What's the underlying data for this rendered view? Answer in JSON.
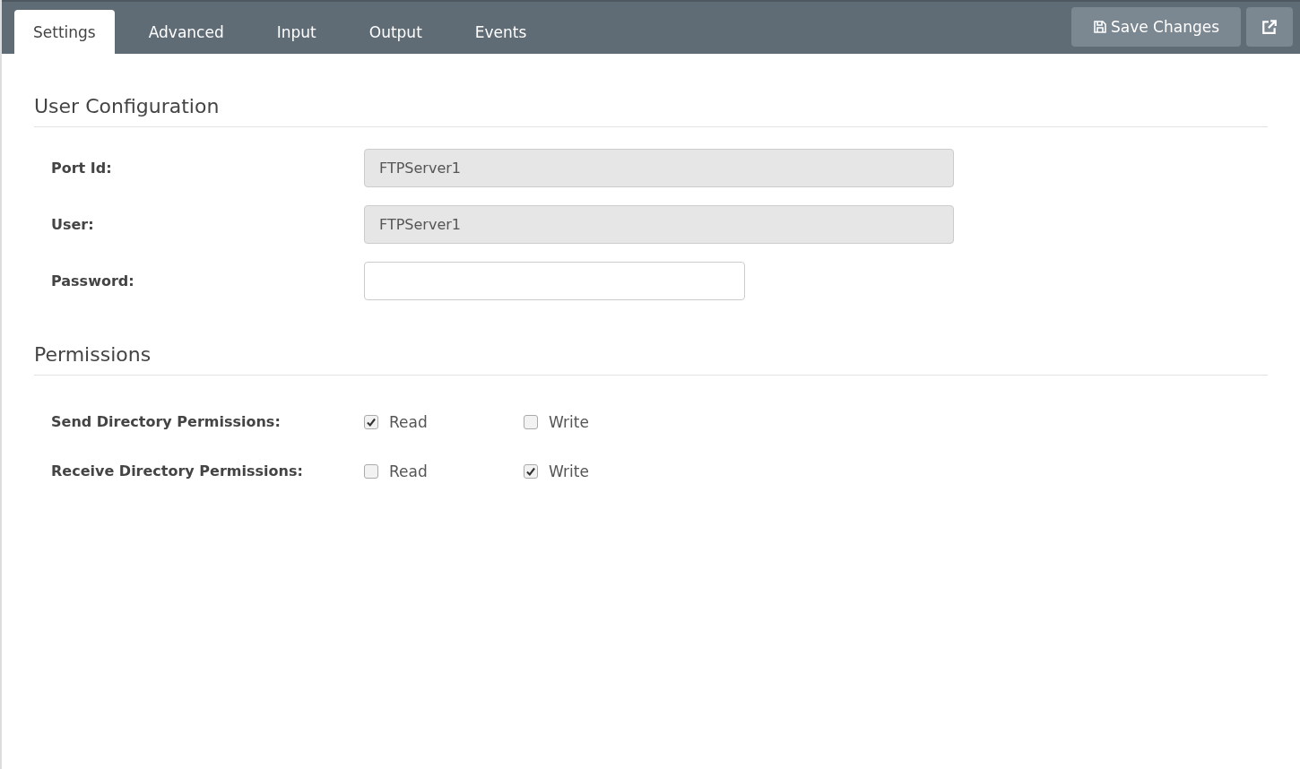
{
  "tabs": [
    {
      "label": "Settings",
      "selected": true
    },
    {
      "label": "Advanced",
      "selected": false
    },
    {
      "label": "Input",
      "selected": false
    },
    {
      "label": "Output",
      "selected": false
    },
    {
      "label": "Events",
      "selected": false
    }
  ],
  "toolbar": {
    "save_label": "Save Changes"
  },
  "sections": [
    {
      "title": "User Configuration",
      "kind": "fields",
      "fields": [
        {
          "label": "Port Id:",
          "value": "FTPServer1",
          "disabled": true,
          "kind": "text"
        },
        {
          "label": "User:",
          "value": "FTPServer1",
          "disabled": true,
          "kind": "text"
        },
        {
          "label": "Password:",
          "disabled": false,
          "kind": "password"
        }
      ]
    },
    {
      "title": "Permissions",
      "kind": "checks",
      "rows": [
        {
          "label": "Send Directory Permissions:",
          "options": [
            {
              "label": "Read",
              "checked": true
            },
            {
              "label": "Write",
              "checked": false
            }
          ]
        },
        {
          "label": "Receive Directory Permissions:",
          "options": [
            {
              "label": "Read",
              "checked": false
            },
            {
              "label": "Write",
              "checked": true
            }
          ]
        }
      ]
    }
  ]
}
